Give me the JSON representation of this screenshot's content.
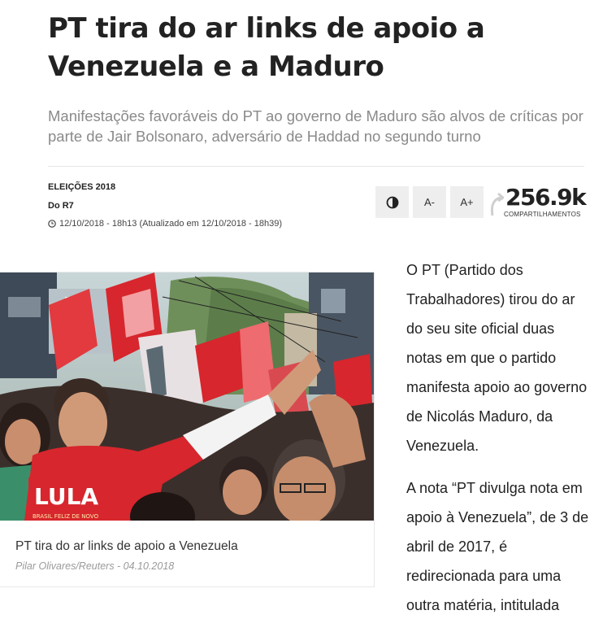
{
  "article": {
    "headline": "PT tira do ar links de apoio a Venezuela e a Maduro",
    "subtitle": "Manifestações favoráveis do PT ao governo de Maduro são alvos de críticas por parte de Jair Bolsonaro, adversário de Haddad no segundo turno",
    "section": "ELEIÇÕES 2018",
    "author": "Do R7",
    "dateline": "12/10/2018 - 18h13 (Atualizado em 12/10/2018 - 18h39)"
  },
  "tools": {
    "contrast_icon": "contrast-icon",
    "font_decrease_label": "A-",
    "font_increase_label": "A+"
  },
  "share": {
    "count": "256.9k",
    "label": "COMPARTILHAMENTOS"
  },
  "figure": {
    "sign_text": "LULA",
    "sign_subtext": "BRASIL FELIZ DE NOVO",
    "caption": "PT tira do ar links de apoio a Venezuela",
    "credit": "Pilar Olivares/Reuters - 04.10.2018"
  },
  "body": {
    "paragraph_1": "O PT (Partido dos Trabalhadores) tirou do ar do seu site oficial duas notas em que o partido manifesta apoio ao governo de Nicolás Maduro, da Venezuela.",
    "paragraph_2": "A nota “PT divulga nota em apoio à Venezuela”, de 3 de abril de 2017, é redirecionada para uma outra matéria, intitulada"
  },
  "colors": {
    "headline": "#222222",
    "subtitle": "#8a8a8a",
    "button_bg": "#eeeeee",
    "flag_red": "#d7262d"
  }
}
